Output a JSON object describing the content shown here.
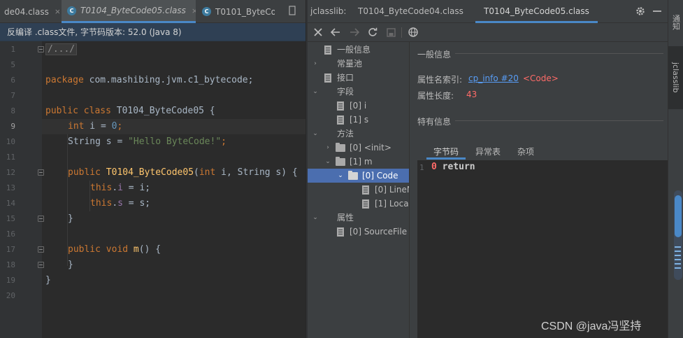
{
  "editor": {
    "tabs": [
      {
        "label": "de04.class",
        "active": false,
        "italic": false
      },
      {
        "label": "T0104_ByteCode05.class",
        "active": true,
        "italic": true
      },
      {
        "label": "T0101_ByteCo",
        "active": false,
        "italic": false
      }
    ],
    "tab_icon_letter": "C",
    "tab_close": "×",
    "banner": "反编译 .class文件, 字节码版本: 52.0 (Java 8)",
    "line_numbers": [
      "1",
      "5",
      "6",
      "7",
      "8",
      "9",
      "10",
      "11",
      "12",
      "13",
      "14",
      "15",
      "16",
      "17",
      "18",
      "19",
      "20"
    ],
    "current_line": "9",
    "code": {
      "l1_fold": "/.../",
      "l6_kw": "package",
      "l6_pkg": " com.mashibing.jvm.c1_bytecode;",
      "l8_kw": "public class",
      "l8_name": " T0104_ByteCode05 {",
      "l9_kw": "int",
      "l9_var": " i = ",
      "l9_num": "0",
      "l9_end": ";",
      "l10_type": "String s = ",
      "l10_str": "\"Hello ByteCode!\"",
      "l10_end": ";",
      "l12_kw": "public",
      "l12_fn": " T0104_ByteCode05",
      "l12_p1": "(",
      "l12_kw2": "int",
      "l12_p2": " i, String s) {",
      "l13_kw": "this",
      "l13_dot": ".",
      "l13_fld": "i",
      "l13_rest": " = i;",
      "l14_kw": "this",
      "l14_dot": ".",
      "l14_fld": "s",
      "l14_rest": " = s;",
      "l15": "}",
      "l17_kw": "public void",
      "l17_fn": " m",
      "l17_rest": "() {",
      "l18": "}",
      "l19": "}"
    }
  },
  "jclasslib": {
    "label": "jclasslib:",
    "tabs": [
      {
        "label": "T0104_ByteCode04.class",
        "active": false
      },
      {
        "label": "T0104_ByteCode05.class",
        "active": true
      }
    ],
    "tree": [
      {
        "label": "一般信息",
        "kind": "file",
        "arrow": ""
      },
      {
        "label": "常量池",
        "kind": "none",
        "arrow": "›"
      },
      {
        "label": "接口",
        "kind": "file",
        "arrow": ""
      },
      {
        "label": "字段",
        "kind": "none",
        "arrow": "⌄"
      },
      {
        "label": "[0] i",
        "kind": "file",
        "arrow": ""
      },
      {
        "label": "[1] s",
        "kind": "file",
        "arrow": ""
      },
      {
        "label": "方法",
        "kind": "none",
        "arrow": "⌄"
      },
      {
        "label": "[0] <init>",
        "kind": "folder",
        "arrow": "›"
      },
      {
        "label": "[1] m",
        "kind": "folder",
        "arrow": "⌄"
      },
      {
        "label": "[0] Code",
        "kind": "folder",
        "arrow": "⌄",
        "selected": true
      },
      {
        "label": "[0] LineN",
        "kind": "file",
        "arrow": ""
      },
      {
        "label": "[1] Loca",
        "kind": "file",
        "arrow": ""
      },
      {
        "label": "属性",
        "kind": "none",
        "arrow": "⌄"
      },
      {
        "label": "[0] SourceFile",
        "kind": "file",
        "arrow": ""
      }
    ],
    "detail": {
      "general_title": "一般信息",
      "name_index_label": "属性名索引:",
      "name_index_link": "cp_info #20",
      "name_index_value": "<Code>",
      "length_label": "属性长度:",
      "length_value": "43",
      "specific_title": "特有信息",
      "subtabs": [
        {
          "label": "字节码",
          "active": true
        },
        {
          "label": "异常表",
          "active": false
        },
        {
          "label": "杂项",
          "active": false
        }
      ],
      "bytecode": {
        "line_no": "1",
        "offset": "0",
        "instruction": "return"
      }
    }
  },
  "right_strip": {
    "tabs": [
      "通知",
      "jclasslib"
    ]
  },
  "watermark": "CSDN @java冯坚持",
  "colors": {
    "accent": "#4a88c7",
    "selection": "#4b6eaf",
    "link": "#589df6",
    "red_value": "#ff6b68"
  }
}
